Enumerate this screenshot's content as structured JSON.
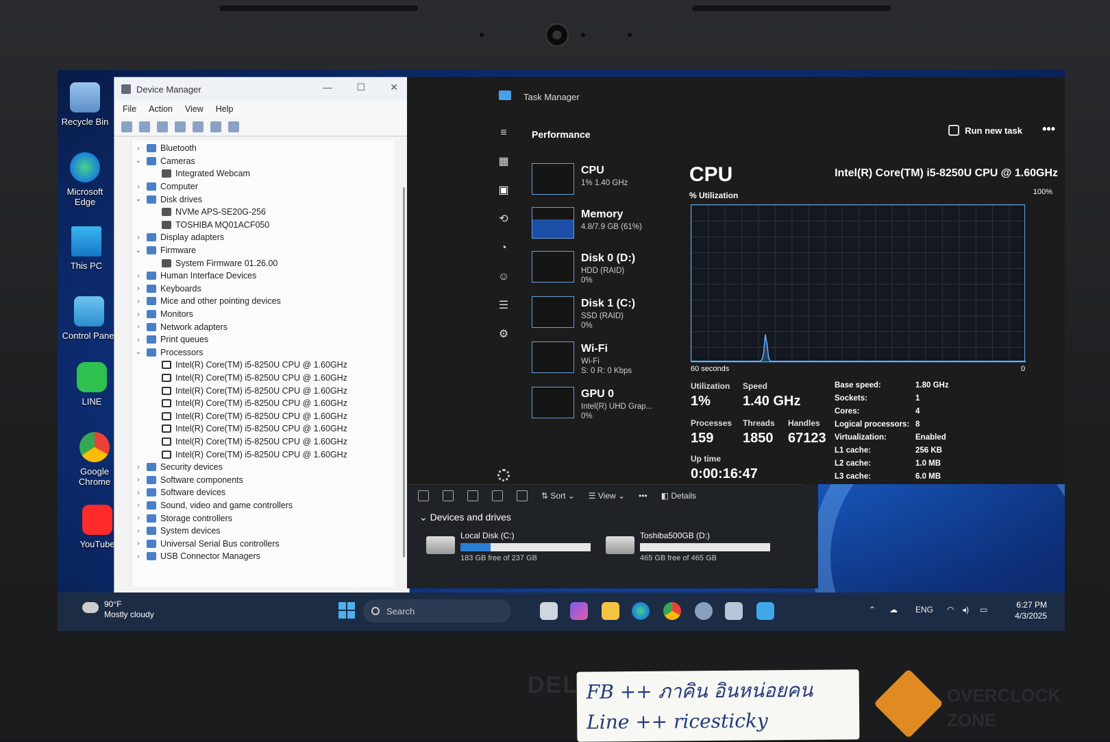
{
  "desktop": {
    "icons": [
      {
        "label": "Recycle Bin"
      },
      {
        "label": "Microsoft Edge"
      },
      {
        "label": "This PC"
      },
      {
        "label": "Control Panel"
      },
      {
        "label": "LINE"
      },
      {
        "label": "Google Chrome"
      },
      {
        "label": "YouTube"
      }
    ]
  },
  "device_manager": {
    "title": "Device Manager",
    "menu": [
      "File",
      "Action",
      "View",
      "Help"
    ],
    "tree": [
      {
        "label": "Bluetooth",
        "level": 0,
        "expanded": false
      },
      {
        "label": "Cameras",
        "level": 0,
        "expanded": true
      },
      {
        "label": "Integrated Webcam",
        "level": 1
      },
      {
        "label": "Computer",
        "level": 0,
        "expanded": false
      },
      {
        "label": "Disk drives",
        "level": 0,
        "expanded": true
      },
      {
        "label": "NVMe APS-SE20G-256",
        "level": 1
      },
      {
        "label": "TOSHIBA MQ01ACF050",
        "level": 1
      },
      {
        "label": "Display adapters",
        "level": 0,
        "expanded": false
      },
      {
        "label": "Firmware",
        "level": 0,
        "expanded": true
      },
      {
        "label": "System Firmware 01.26.00",
        "level": 1
      },
      {
        "label": "Human Interface Devices",
        "level": 0,
        "expanded": false
      },
      {
        "label": "Keyboards",
        "level": 0,
        "expanded": false
      },
      {
        "label": "Mice and other pointing devices",
        "level": 0,
        "expanded": false
      },
      {
        "label": "Monitors",
        "level": 0,
        "expanded": false
      },
      {
        "label": "Network adapters",
        "level": 0,
        "expanded": false
      },
      {
        "label": "Print queues",
        "level": 0,
        "expanded": false
      },
      {
        "label": "Processors",
        "level": 0,
        "expanded": true
      },
      {
        "label": "Intel(R) Core(TM) i5-8250U CPU @ 1.60GHz",
        "level": 1,
        "cpu": true
      },
      {
        "label": "Intel(R) Core(TM) i5-8250U CPU @ 1.60GHz",
        "level": 1,
        "cpu": true
      },
      {
        "label": "Intel(R) Core(TM) i5-8250U CPU @ 1.60GHz",
        "level": 1,
        "cpu": true
      },
      {
        "label": "Intel(R) Core(TM) i5-8250U CPU @ 1.60GHz",
        "level": 1,
        "cpu": true
      },
      {
        "label": "Intel(R) Core(TM) i5-8250U CPU @ 1.60GHz",
        "level": 1,
        "cpu": true
      },
      {
        "label": "Intel(R) Core(TM) i5-8250U CPU @ 1.60GHz",
        "level": 1,
        "cpu": true
      },
      {
        "label": "Intel(R) Core(TM) i5-8250U CPU @ 1.60GHz",
        "level": 1,
        "cpu": true
      },
      {
        "label": "Intel(R) Core(TM) i5-8250U CPU @ 1.60GHz",
        "level": 1,
        "cpu": true
      },
      {
        "label": "Security devices",
        "level": 0,
        "expanded": false
      },
      {
        "label": "Software components",
        "level": 0,
        "expanded": false
      },
      {
        "label": "Software devices",
        "level": 0,
        "expanded": false
      },
      {
        "label": "Sound, video and game controllers",
        "level": 0,
        "expanded": false
      },
      {
        "label": "Storage controllers",
        "level": 0,
        "expanded": false
      },
      {
        "label": "System devices",
        "level": 0,
        "expanded": false
      },
      {
        "label": "Universal Serial Bus controllers",
        "level": 0,
        "expanded": false
      },
      {
        "label": "USB Connector Managers",
        "level": 0,
        "expanded": false
      }
    ]
  },
  "task_manager": {
    "title": "Task Manager",
    "section": "Performance",
    "run_new_task": "Run new task",
    "more": "•••",
    "resources": [
      {
        "name": "CPU",
        "sub": [
          "1% 1.40 GHz"
        ],
        "fill": 0.0
      },
      {
        "name": "Memory",
        "sub": [
          "4.8/7.9 GB (61%)"
        ],
        "fill": 0.61
      },
      {
        "name": "Disk 0 (D:)",
        "sub": [
          "HDD (RAID)",
          "0%"
        ],
        "fill": 0.0
      },
      {
        "name": "Disk 1 (C:)",
        "sub": [
          "SSD (RAID)",
          "0%"
        ],
        "fill": 0.0
      },
      {
        "name": "Wi-Fi",
        "sub": [
          "Wi-Fi",
          "S: 0 R: 0 Kbps"
        ],
        "fill": 0.0
      },
      {
        "name": "GPU 0",
        "sub": [
          "Intel(R) UHD Grap...",
          "0%"
        ],
        "fill": 0.0
      }
    ],
    "detail_title": "CPU",
    "cpu_model": "Intel(R) Core(TM) i5-8250U CPU @ 1.60GHz",
    "util_label": "% Utilization",
    "util_max": "100%",
    "x_left": "60 seconds",
    "x_right": "0",
    "stats": {
      "utilization_label": "Utilization",
      "utilization": "1%",
      "speed_label": "Speed",
      "speed": "1.40 GHz",
      "processes_label": "Processes",
      "processes": "159",
      "threads_label": "Threads",
      "threads": "1850",
      "handles_label": "Handles",
      "handles": "67123",
      "uptime_label": "Up time",
      "uptime": "0:00:16:47"
    },
    "specs": [
      {
        "k": "Base speed:",
        "v": "1.80 GHz"
      },
      {
        "k": "Sockets:",
        "v": "1"
      },
      {
        "k": "Cores:",
        "v": "4"
      },
      {
        "k": "Logical processors:",
        "v": "8"
      },
      {
        "k": "Virtualization:",
        "v": "Enabled"
      },
      {
        "k": "L1 cache:",
        "v": "256 KB"
      },
      {
        "k": "L2 cache:",
        "v": "1.0 MB"
      },
      {
        "k": "L3 cache:",
        "v": "6.0 MB"
      }
    ],
    "cpu_history": [
      1,
      1,
      1,
      1,
      1,
      1,
      1,
      1,
      1,
      1,
      1,
      1,
      1,
      1,
      1,
      1,
      1,
      1,
      1,
      1,
      1,
      1,
      1,
      1,
      1,
      1,
      1,
      1,
      1,
      1,
      1,
      1,
      1,
      1,
      1,
      1,
      1,
      1,
      1,
      1,
      1,
      1,
      2,
      6,
      18,
      12,
      3,
      1,
      1,
      1,
      1,
      1,
      1,
      1,
      1,
      1,
      1,
      1,
      1,
      1,
      1,
      1,
      1,
      1,
      1,
      1,
      1,
      1,
      1,
      1,
      1,
      1,
      1,
      1,
      1,
      1,
      1,
      1,
      1,
      1,
      1,
      1,
      1,
      1,
      1,
      1,
      1,
      1,
      1,
      1,
      1,
      1,
      1,
      1,
      1,
      1,
      1,
      1,
      1,
      1,
      1,
      1,
      1,
      1,
      1,
      1,
      1,
      1,
      1,
      1,
      1,
      1,
      1,
      1,
      1,
      1,
      1,
      1,
      1,
      1,
      1,
      1,
      1,
      1,
      1,
      1,
      1,
      1,
      1,
      1,
      1,
      1,
      1,
      1,
      1,
      1,
      1,
      1,
      1,
      1,
      1,
      1,
      1,
      1,
      1,
      1,
      1,
      1,
      1,
      1,
      1,
      1,
      1,
      1,
      1,
      1,
      1,
      1,
      1,
      1,
      1,
      1,
      1,
      1,
      1,
      1,
      1,
      1,
      1,
      1,
      1,
      1,
      1,
      1,
      1,
      1,
      1,
      1,
      1,
      1,
      1,
      1,
      1,
      1,
      1,
      1,
      1,
      1,
      1,
      1,
      1,
      1,
      1,
      1,
      1,
      1,
      1,
      1,
      1,
      1
    ]
  },
  "file_explorer": {
    "toolbar": {
      "sort": "Sort",
      "view": "View",
      "more": "•••",
      "details": "Details"
    },
    "section": "Devices and drives",
    "drives": [
      {
        "name": "Local Disk (C:)",
        "free": "183 GB free of 237 GB",
        "used_fraction": 0.23
      },
      {
        "name": "Toshiba500GB (D:)",
        "free": "465 GB free of 465 GB",
        "used_fraction": 0.0
      }
    ]
  },
  "taskbar": {
    "weather_temp": "90°F",
    "weather_desc": "Mostly cloudy",
    "search_placeholder": "Search",
    "lang": "ENG",
    "time": "6:27 PM",
    "date": "4/3/2025"
  },
  "sticker": {
    "line1": "FB ++ ภาคิน อินหน่อยคน",
    "line2": "Line ++ ricesticky"
  },
  "brand": {
    "laptop": "DELL",
    "watermark": "OVERCLOCK ZONE"
  }
}
